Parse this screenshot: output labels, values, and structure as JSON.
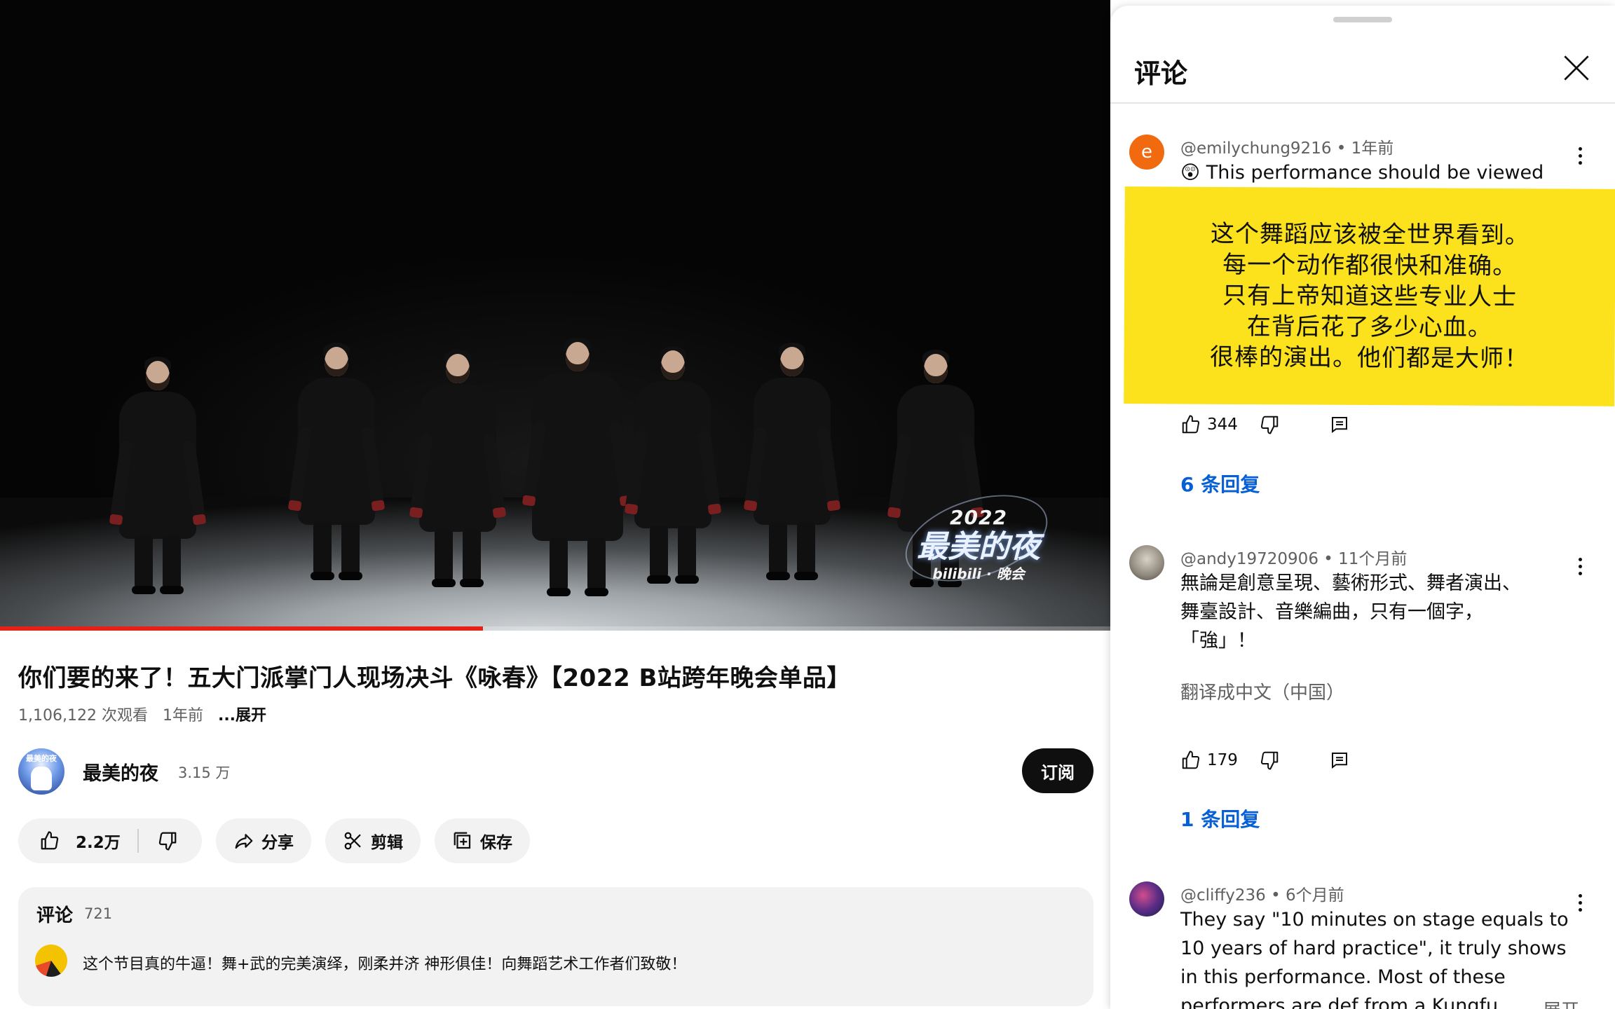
{
  "video": {
    "watermark": {
      "year": "2022",
      "name": "最美的夜",
      "sub": "bilibili · 晚会"
    },
    "progress_fraction": 0.435
  },
  "title": "你们要的来了！五大门派掌门人现场决斗《咏春》【2022 B站跨年晚会单品】",
  "meta": {
    "views": "1,106,122 次观看",
    "age": "1年前",
    "more": "...展开"
  },
  "channel": {
    "name": "最美的夜",
    "subscribers": "3.15 万",
    "avatar_text": "最美的夜",
    "subscribe_label": "订阅"
  },
  "actions": {
    "likes": "2.2万",
    "share": "分享",
    "clip": "剪辑",
    "save": "保存"
  },
  "comments_preview": {
    "heading": "评论",
    "count": "721",
    "top_comment": "这个节目真的牛逼！舞+武的完美演绎，刚柔并济 神形俱佳！向舞蹈艺术工作者们致敬！"
  },
  "panel": {
    "title": "评论",
    "comments": [
      {
        "author": "@emilychung9216",
        "age": "1年前",
        "avatar_letter": "e",
        "text": "😲 This performance should be viewed",
        "likes": "344",
        "replies": "6 条回复",
        "overlay_lines": [
          "这个舞蹈应该被全世界看到。",
          "每一个动作都很快和准确。",
          "只有上帝知道这些专业人士",
          "在背后花了多少心血。",
          "很棒的演出。他们都是大师！"
        ]
      },
      {
        "author": "@andy19720906",
        "age": "11个月前",
        "text_lines": [
          "無論是創意呈現、藝術形式、舞者演出、",
          "舞臺設計、音樂編曲，只有一個字，",
          "「強」！"
        ],
        "translate": "翻译成中文（中国）",
        "likes": "179",
        "replies": "1 条回复"
      },
      {
        "author": "@cliffy236",
        "age": "6个月前",
        "text_lines": [
          "They say \"10 minutes on stage equals to",
          "10 years of hard practice\", it truly shows",
          "in this performance. Most of these",
          "performers are def from a Kungfu"
        ],
        "expand": "... 展开"
      }
    ]
  },
  "colors": {
    "accent_red": "#e62117",
    "link_blue": "#065fd4",
    "highlight_yellow": "#fbe21d"
  }
}
